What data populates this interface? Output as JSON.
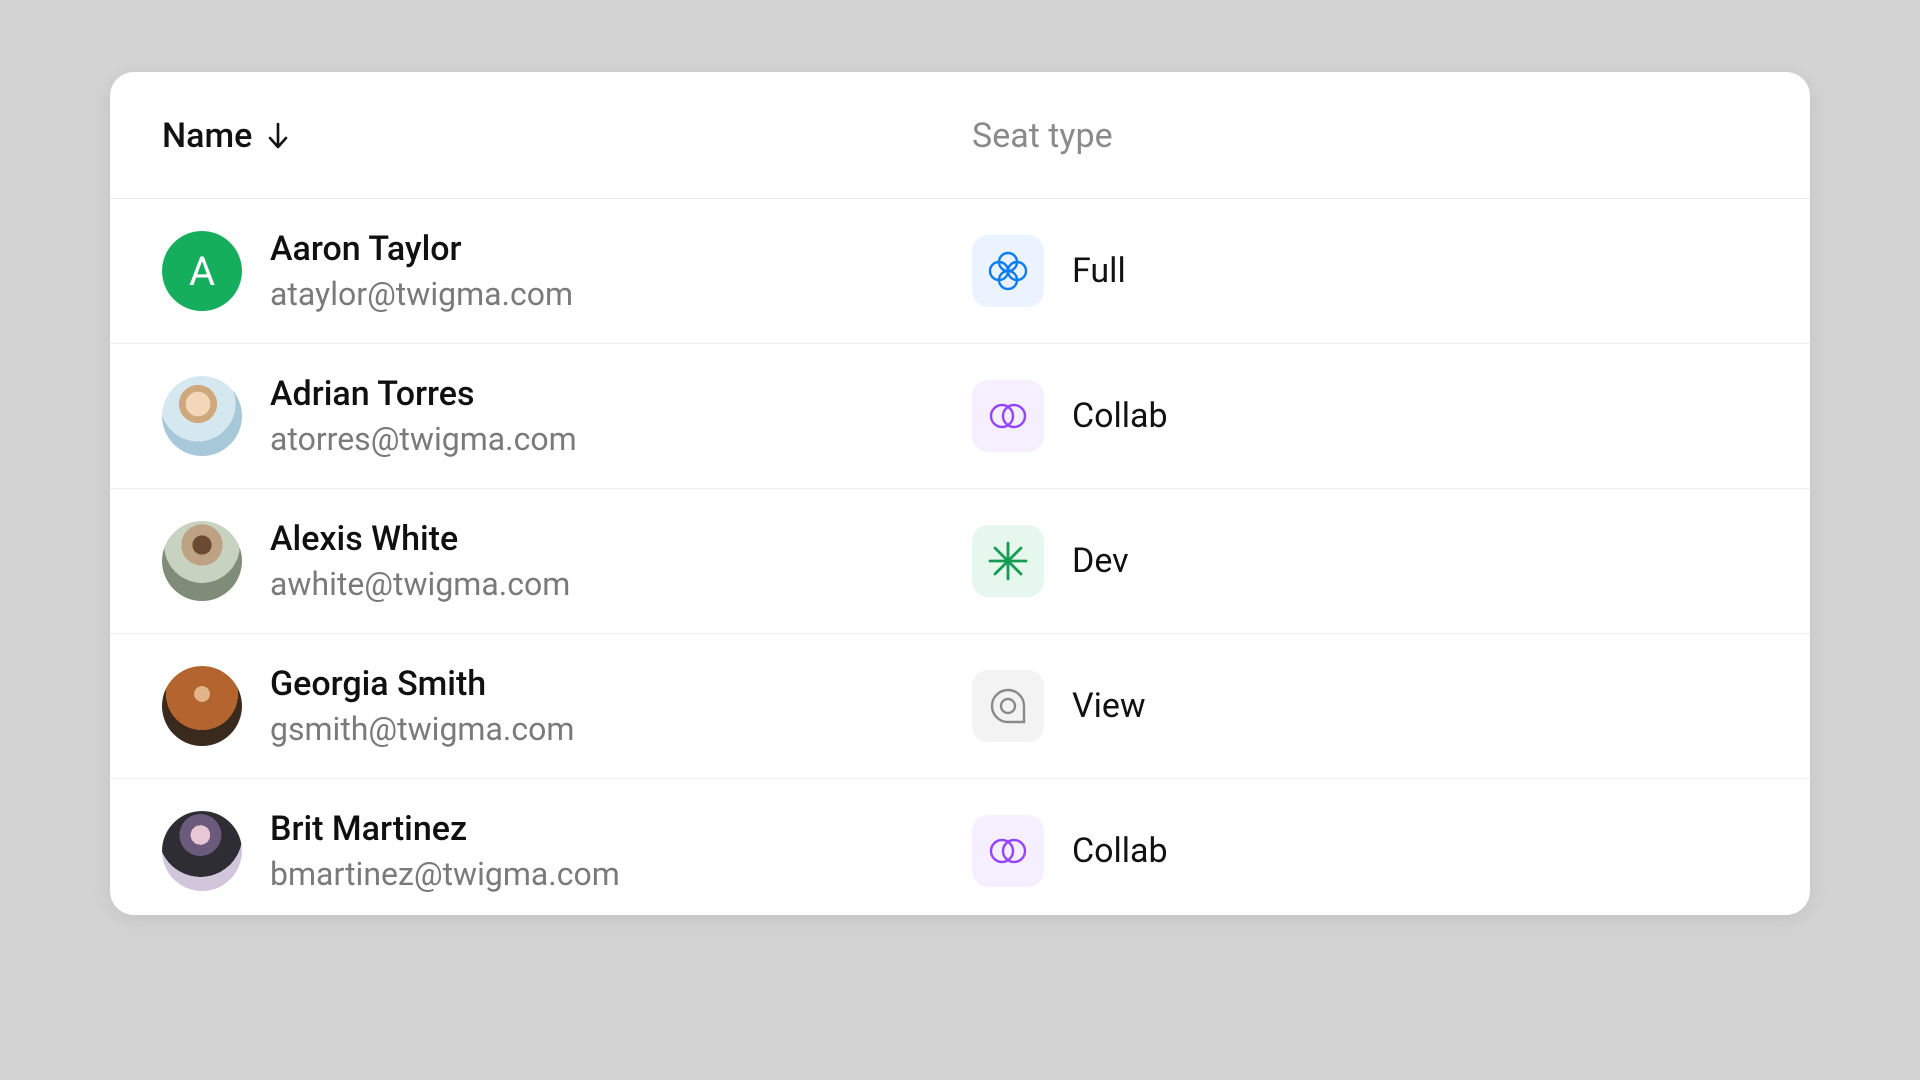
{
  "columns": {
    "name": "Name",
    "seat_type": "Seat type"
  },
  "sort": {
    "column": "name",
    "direction": "asc"
  },
  "seat_types": {
    "full": {
      "label": "Full",
      "icon": "full-seat-icon",
      "color": "#0d7df2",
      "bg": "#eaf3ff"
    },
    "collab": {
      "label": "Collab",
      "icon": "collab-seat-icon",
      "color": "#9545ff",
      "bg": "#f5efff"
    },
    "dev": {
      "label": "Dev",
      "icon": "dev-seat-icon",
      "color": "#169c52",
      "bg": "#e6f8ed"
    },
    "view": {
      "label": "View",
      "icon": "view-seat-icon",
      "color": "#8a8a8a",
      "bg": "#f3f3f3"
    }
  },
  "users": [
    {
      "name": "Aaron Taylor",
      "email": "ataylor@twigma.com",
      "avatar_kind": "initial",
      "avatar_initial": "A",
      "avatar_color": "#14ae5c",
      "seat": "full"
    },
    {
      "name": "Adrian Torres",
      "email": "atorres@twigma.com",
      "avatar_kind": "photo",
      "seat": "collab"
    },
    {
      "name": "Alexis White",
      "email": "awhite@twigma.com",
      "avatar_kind": "photo",
      "seat": "dev"
    },
    {
      "name": "Georgia Smith",
      "email": "gsmith@twigma.com",
      "avatar_kind": "photo",
      "seat": "view"
    },
    {
      "name": "Brit Martinez",
      "email": "bmartinez@twigma.com",
      "avatar_kind": "photo",
      "seat": "collab"
    }
  ]
}
